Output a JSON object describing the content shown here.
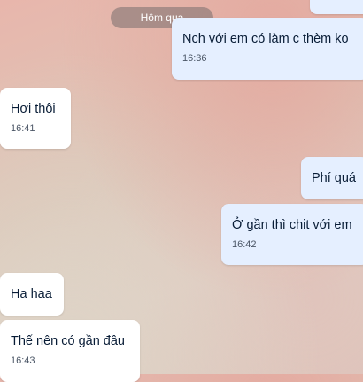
{
  "date_separator": "Hôm qua",
  "messages": [
    {
      "text": "",
      "time": "",
      "side": "sent"
    },
    {
      "text": "Nch với em có làm c thèm ko",
      "time": "16:36",
      "side": "sent"
    },
    {
      "text": "Hơi thôi",
      "time": "16:41",
      "side": "received"
    },
    {
      "text": "Phí quá",
      "time": "",
      "side": "sent"
    },
    {
      "text": "Ở gần thì chit với em",
      "time": "16:42",
      "side": "sent"
    },
    {
      "text": "Ha haa",
      "time": "",
      "side": "received"
    },
    {
      "text": "Thế nên có gần đâu",
      "time": "16:43",
      "side": "received"
    }
  ],
  "colors": {
    "sent_bubble": "#e5efff",
    "received_bubble": "#ffffff",
    "text": "#081c36"
  }
}
